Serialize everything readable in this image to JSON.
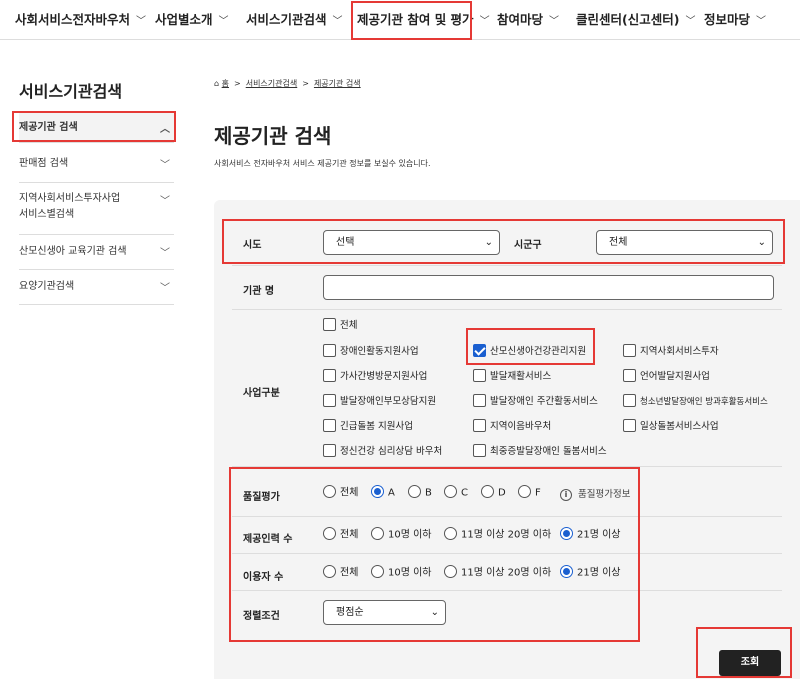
{
  "nav": {
    "items": [
      {
        "label": "사회서비스전자바우처"
      },
      {
        "label": "사업별소개"
      },
      {
        "label": "서비스기관검색"
      },
      {
        "label": "제공기관 참여 및 평가"
      },
      {
        "label": "참여마당"
      },
      {
        "label": "클린센터(신고센터)"
      },
      {
        "label": "정보마당"
      }
    ]
  },
  "sidebar": {
    "title": "서비스기관검색",
    "items": [
      {
        "label": "제공기관 검색"
      },
      {
        "label": "판매점 검색"
      },
      {
        "label": "지역사회서비스투자사업 서비스별검색"
      },
      {
        "label": "산모신생아 교육기관 검색"
      },
      {
        "label": "요양기관검색"
      }
    ]
  },
  "breadcrumb": {
    "home": "홈",
    "level1": "서비스기관검색",
    "level2": "제공기관 검색"
  },
  "page": {
    "title": "제공기관 검색",
    "description": "사회서비스 전자바우처 서비스 제공기관 정보를 보실수 있습니다."
  },
  "form": {
    "sido_label": "시도",
    "sido_value": "선택",
    "sigungu_label": "시군구",
    "sigungu_value": "전체",
    "name_label": "기관 명",
    "name_value": "",
    "business_label": "사업구분",
    "business_options": [
      {
        "label": "전체",
        "checked": false
      },
      {
        "label": "장애인활동지원사업",
        "checked": false
      },
      {
        "label": "산모신생아건강관리지원",
        "checked": true
      },
      {
        "label": "지역사회서비스투자",
        "checked": false
      },
      {
        "label": "가사간병방문지원사업",
        "checked": false
      },
      {
        "label": "발달재활서비스",
        "checked": false
      },
      {
        "label": "언어발달지원사업",
        "checked": false
      },
      {
        "label": "발달장애인부모상담지원",
        "checked": false
      },
      {
        "label": "발달장애인 주간활동서비스",
        "checked": false
      },
      {
        "label": "청소년발달장애인 방과후활동서비스",
        "checked": false
      },
      {
        "label": "긴급돌봄 지원사업",
        "checked": false
      },
      {
        "label": "지역이음바우처",
        "checked": false
      },
      {
        "label": "일상돌봄서비스사업",
        "checked": false
      },
      {
        "label": "정신건강 심리상담 바우처",
        "checked": false
      },
      {
        "label": "최중증발달장애인 돌봄서비스",
        "checked": false
      }
    ],
    "quality_label": "품질평가",
    "quality_options": [
      {
        "label": "전체",
        "checked": false
      },
      {
        "label": "A",
        "checked": true
      },
      {
        "label": "B",
        "checked": false
      },
      {
        "label": "C",
        "checked": false
      },
      {
        "label": "D",
        "checked": false
      },
      {
        "label": "F",
        "checked": false
      }
    ],
    "quality_info": "품질평가정보",
    "staff_label": "제공인력 수",
    "staff_options": [
      {
        "label": "전체",
        "checked": false
      },
      {
        "label": "10명 이하",
        "checked": false
      },
      {
        "label": "11명 이상 20명 이하",
        "checked": false
      },
      {
        "label": "21명 이상",
        "checked": true
      }
    ],
    "users_label": "이용자 수",
    "users_options": [
      {
        "label": "전체",
        "checked": false
      },
      {
        "label": "10명 이하",
        "checked": false
      },
      {
        "label": "11명 이상 20명 이하",
        "checked": false
      },
      {
        "label": "21명 이상",
        "checked": true
      }
    ],
    "sort_label": "정렬조건",
    "sort_value": "평점순",
    "search_button": "조회"
  }
}
